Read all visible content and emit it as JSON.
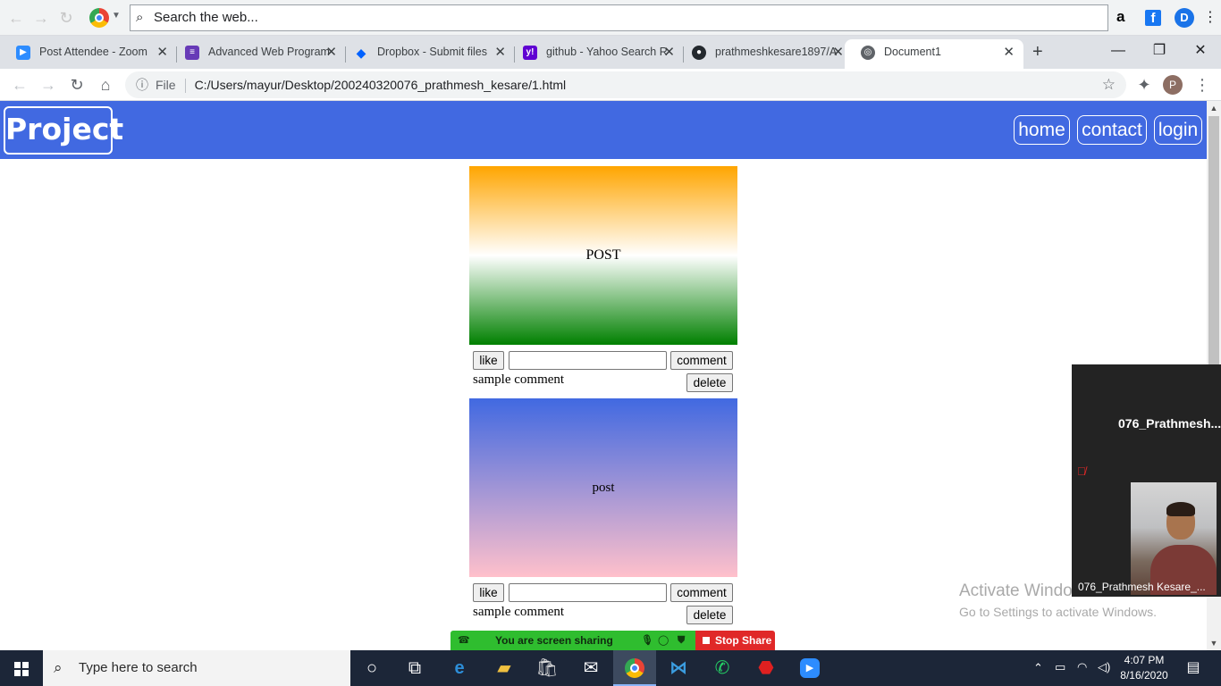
{
  "browser_toolbar": {
    "search_placeholder": "Search the web...",
    "icons": [
      "back-arrow-icon",
      "forward-arrow-icon",
      "reload-icon",
      "chrome-logo-icon",
      "amazon-icon",
      "facebook-icon",
      "d-extension-icon",
      "menu-dots-icon"
    ]
  },
  "tabs": [
    {
      "title": "Post Attendee - Zoom",
      "icon": "zoom-icon",
      "color": "#2d8cff"
    },
    {
      "title": "Advanced Web Program",
      "icon": "forms-icon",
      "color": "#673ab7"
    },
    {
      "title": "Dropbox - Submit files",
      "icon": "dropbox-icon",
      "color": "#0061fe"
    },
    {
      "title": "github - Yahoo Search R",
      "icon": "yahoo-icon",
      "color": "#6001d2"
    },
    {
      "title": "prathmeshkesare1897/A",
      "icon": "github-icon",
      "color": "#24292e"
    },
    {
      "title": "Document1",
      "icon": "globe-icon",
      "color": "#5f6368",
      "active": true
    }
  ],
  "address_bar": {
    "scheme_label": "File",
    "url": "C:/Users/mayur/Desktop/200240320076_prathmesh_kesare/1.html",
    "profile_initial": "P"
  },
  "page": {
    "brand": "Project",
    "nav": [
      "home",
      "contact",
      "login"
    ],
    "posts": [
      {
        "text": "POST",
        "like_label": "like",
        "comment_label": "comment",
        "comment_text": "sample comment",
        "delete_label": "delete"
      },
      {
        "text": "post",
        "like_label": "like",
        "comment_label": "comment",
        "comment_text": "sample comment",
        "delete_label": "delete"
      }
    ]
  },
  "zoom": {
    "participant_title": "076_Prathmesh...",
    "video_label": "076_Prathmesh Kesare_...",
    "share_status": "You are screen sharing",
    "stop_share": "Stop Share"
  },
  "watermark": {
    "line1": "Activate Windows",
    "line2": "Go to Settings to activate Windows."
  },
  "taskbar": {
    "search_placeholder": "Type here to search",
    "time": "4:07 PM",
    "date": "8/16/2020"
  },
  "colors": {
    "navbar": "#4169e1",
    "post1_gradient": [
      "#ffa500",
      "#ffffff",
      "#008000"
    ],
    "post2_gradient": [
      "#4169e1",
      "#ffc0cb"
    ],
    "share_bar": "#2fbd2f",
    "stop_share": "#e02828"
  }
}
